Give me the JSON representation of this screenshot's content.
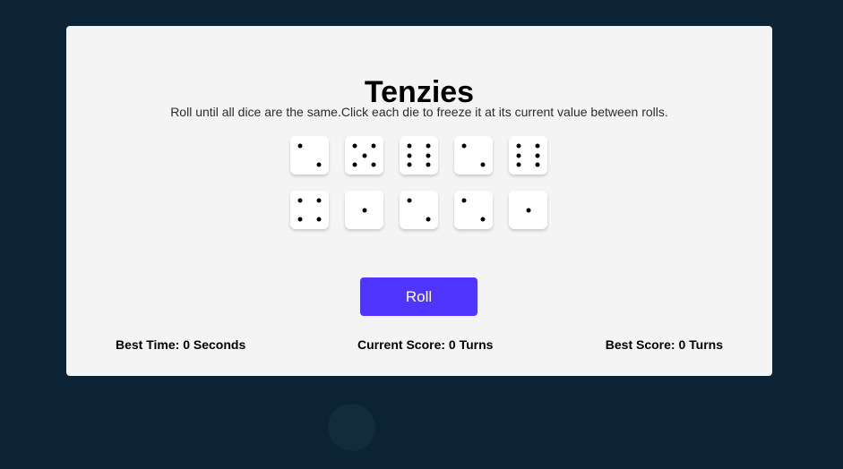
{
  "game": {
    "title": "Tenzies",
    "instructions": "Roll until all dice are the same.Click each die to freeze it at its current value between rolls.",
    "dice": [
      {
        "value": 2
      },
      {
        "value": 5
      },
      {
        "value": 6
      },
      {
        "value": 2
      },
      {
        "value": 6
      },
      {
        "value": 4
      },
      {
        "value": 1
      },
      {
        "value": 2
      },
      {
        "value": 2
      },
      {
        "value": 1
      }
    ],
    "roll_label": "Roll",
    "best_time_text": "Best Time: 0 Seconds",
    "current_score_text": "Current Score: 0 Turns",
    "best_score_text": "Best Score: 0 Turns"
  },
  "colors": {
    "page_background": "#0b2334",
    "card_background": "#f4f4f4",
    "button_accent": "#5035ff",
    "die_face": "#ffffff",
    "pip": "#000000"
  }
}
